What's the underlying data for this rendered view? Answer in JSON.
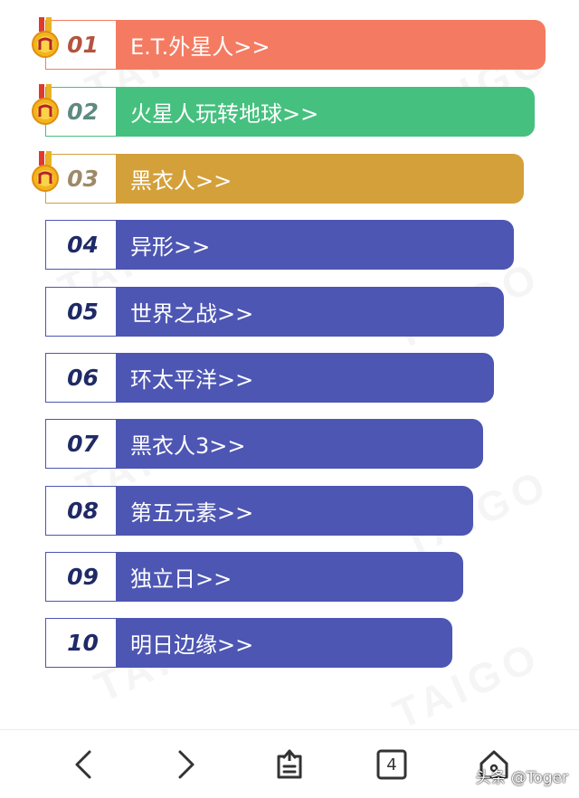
{
  "colors": {
    "rank1": "#f47b61",
    "rank2": "#46c07f",
    "rank3": "#d4a03a",
    "other": "#4d56b3",
    "num1": "#b4543f",
    "num2": "#5e8a7f",
    "num3": "#9e8a6a",
    "numOther": "#1f2a66"
  },
  "items": [
    {
      "rank": "01",
      "title": "E.T.外星人>>"
    },
    {
      "rank": "02",
      "title": "火星人玩转地球>>"
    },
    {
      "rank": "03",
      "title": "黑衣人>>"
    },
    {
      "rank": "04",
      "title": "异形>>"
    },
    {
      "rank": "05",
      "title": "世界之战>>"
    },
    {
      "rank": "06",
      "title": "环太平洋>>"
    },
    {
      "rank": "07",
      "title": "黑衣人3>>"
    },
    {
      "rank": "08",
      "title": "第五元素>>"
    },
    {
      "rank": "09",
      "title": "独立日>>"
    },
    {
      "rank": "10",
      "title": "明日边缘>>"
    }
  ],
  "watermark": "TAIGO",
  "nav": {
    "tab_count": "4",
    "brand": "头条 @Toger"
  },
  "icons": [
    "medal-icon",
    "back-icon",
    "forward-icon",
    "share-icon",
    "tabs-icon",
    "home-icon"
  ]
}
